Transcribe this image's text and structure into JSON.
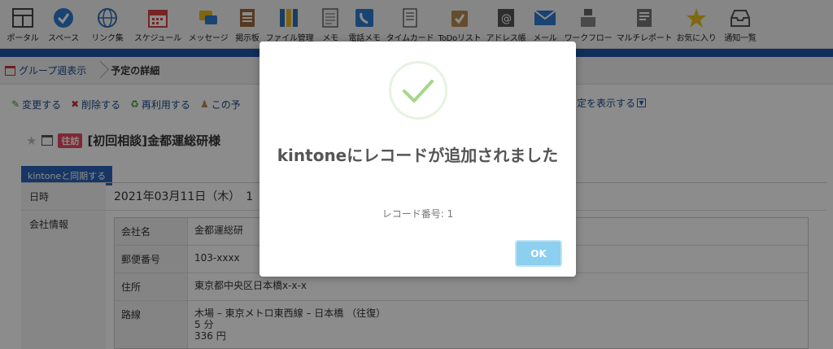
{
  "toolbar": [
    {
      "label": "ポータル",
      "icon": "portal-icon"
    },
    {
      "label": "スペース",
      "icon": "space-icon"
    },
    {
      "label": "リンク集",
      "icon": "link-icon"
    },
    {
      "label": "スケジュール",
      "icon": "calendar-icon"
    },
    {
      "label": "メッセージ",
      "icon": "message-icon"
    },
    {
      "label": "掲示板",
      "icon": "bulletin-icon"
    },
    {
      "label": "ファイル管理",
      "icon": "file-icon"
    },
    {
      "label": "メモ",
      "icon": "memo-icon"
    },
    {
      "label": "電話メモ",
      "icon": "phone-icon"
    },
    {
      "label": "タイムカード",
      "icon": "timecard-icon"
    },
    {
      "label": "ToDoリスト",
      "icon": "todo-icon"
    },
    {
      "label": "アドレス帳",
      "icon": "address-icon"
    },
    {
      "label": "メール",
      "icon": "mail-icon"
    },
    {
      "label": "ワークフロー",
      "icon": "workflow-icon"
    },
    {
      "label": "マルチレポート",
      "icon": "report-icon"
    },
    {
      "label": "お気に入り",
      "icon": "star-icon"
    },
    {
      "label": "通知一覧",
      "icon": "inbox-icon"
    }
  ],
  "breadcrumb": {
    "parent": "グループ週表示",
    "current": "予定の詳細"
  },
  "actions": {
    "edit": "変更する",
    "delete": "削除する",
    "reuse": "再利用する",
    "this": "この予",
    "right": "定を表示する"
  },
  "title": {
    "badge": "往訪",
    "text": "[初回相談]金都運総研様"
  },
  "sync_tab": "kintoneと同期する",
  "details": {
    "datetime_label": "日時",
    "datetime_value": "2021年03月11日（木）　1",
    "company_label": "会社情報",
    "rows": [
      {
        "label": "会社名",
        "value": "金都運総研"
      },
      {
        "label": "郵便番号",
        "value": "103-xxxx"
      },
      {
        "label": "住所",
        "value": "東京都中央区日本橋x-x-x"
      },
      {
        "label": "路線",
        "value": "木場 – 東京メトロ東西線 – 日本橋 （往復）",
        "line2": "5 分",
        "line3": "336 円"
      }
    ]
  },
  "modal": {
    "title": "kintoneにレコードが追加されました",
    "text": "レコード番号: 1",
    "ok": "OK"
  },
  "colors": {
    "accent": "#1e56a7",
    "ok_button": "#8ccfef",
    "check": "#a6d68a",
    "badge": "#e84a5f"
  }
}
